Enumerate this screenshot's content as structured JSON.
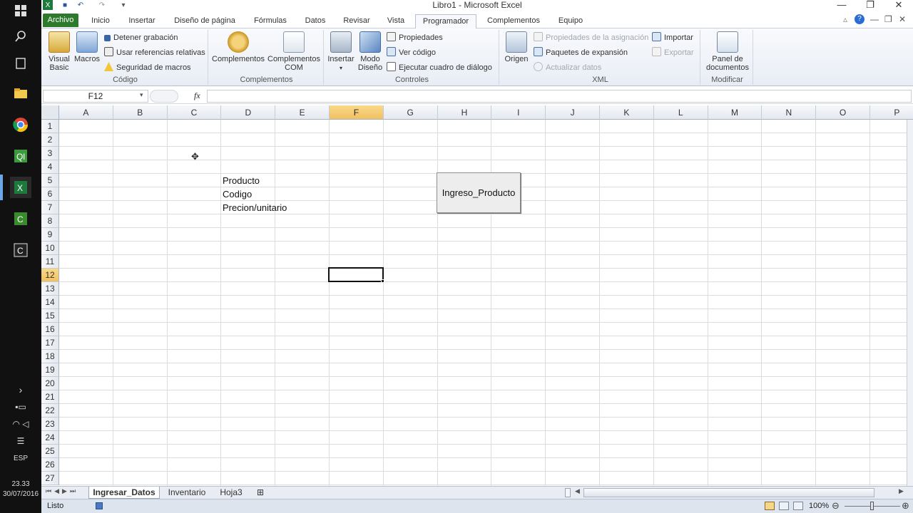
{
  "window": {
    "title": "Libro1 - Microsoft Excel",
    "minimize": "—",
    "restore": "❐",
    "close": "✕"
  },
  "taskbar": {
    "language": "ESP",
    "time": "23.33",
    "date": "30/07/2016"
  },
  "tabs": [
    "Archivo",
    "Inicio",
    "Insertar",
    "Diseño de página",
    "Fórmulas",
    "Datos",
    "Revisar",
    "Vista",
    "Programador",
    "Complementos",
    "Equipo"
  ],
  "ribbon": {
    "codigo": {
      "label": "Código",
      "visual_basic": "Visual Basic",
      "macros": "Macros",
      "detener": "Detener grabación",
      "usar_ref": "Usar referencias relativas",
      "seguridad": "Seguridad de macros"
    },
    "complementos": {
      "label": "Complementos",
      "complementos": "Complementos",
      "complementos_com_1": "Complementos",
      "complementos_com_2": "COM"
    },
    "controles": {
      "label": "Controles",
      "insertar": "Insertar",
      "modo_1": "Modo",
      "modo_2": "Diseño",
      "propiedades": "Propiedades",
      "ver_codigo": "Ver código",
      "ejecutar": "Ejecutar cuadro de diálogo"
    },
    "xml": {
      "label": "XML",
      "origen": "Origen",
      "prop_asig": "Propiedades de la asignación",
      "paquetes": "Paquetes de expansión",
      "actualizar": "Actualizar datos",
      "importar": "Importar",
      "exportar": "Exportar"
    },
    "modificar": {
      "label": "Modificar",
      "panel_1": "Panel de",
      "panel_2": "documentos"
    }
  },
  "formula_bar": {
    "name_box": "F12",
    "fx": "fx",
    "value": ""
  },
  "columns": [
    "A",
    "B",
    "C",
    "D",
    "E",
    "F",
    "G",
    "H",
    "I",
    "J",
    "K",
    "L",
    "M",
    "N",
    "O",
    "P"
  ],
  "rows": [
    "1",
    "2",
    "3",
    "4",
    "5",
    "6",
    "7",
    "8",
    "9",
    "10",
    "11",
    "12",
    "13",
    "14",
    "15",
    "16",
    "17",
    "18",
    "19",
    "20",
    "21",
    "22",
    "23",
    "24",
    "25",
    "26",
    "27"
  ],
  "cells": {
    "D5": "Producto",
    "D6": "Codigo",
    "D7": "Precion/unitario"
  },
  "form_button": {
    "label": "Ingreso_Producto"
  },
  "sheets": [
    "Ingresar_Datos",
    "Inventario",
    "Hoja3"
  ],
  "status": {
    "ready": "Listo",
    "zoom": "100%"
  }
}
